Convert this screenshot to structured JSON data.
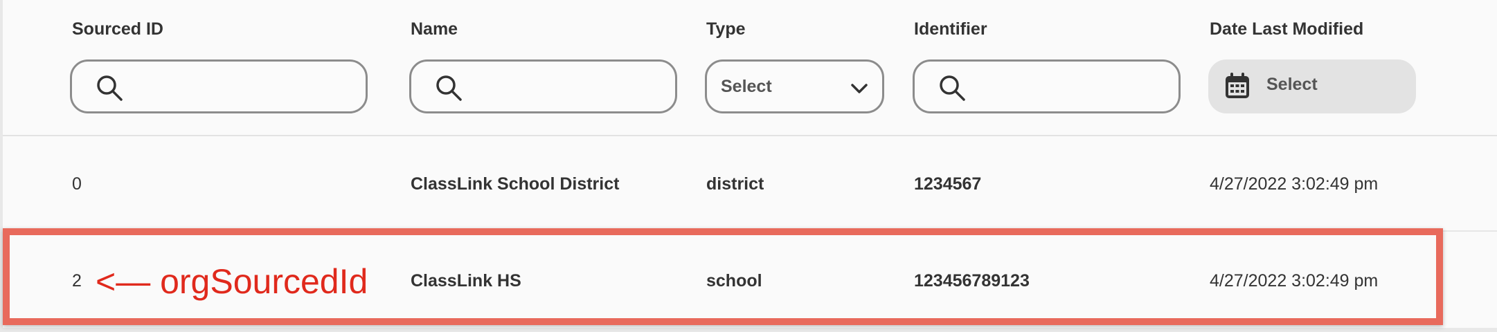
{
  "columns": {
    "sourced_id": "Sourced ID",
    "name": "Name",
    "type": "Type",
    "identifier": "Identifier",
    "date_last_modified": "Date Last Modified"
  },
  "filters": {
    "sourced_id_value": "",
    "name_value": "",
    "type_select": "Select",
    "identifier_value": "",
    "date_select": "Select"
  },
  "rows": [
    {
      "sourced_id": "0",
      "name": "ClassLink School District",
      "type": "district",
      "identifier": "1234567",
      "date_last_modified": "4/27/2022 3:02:49 pm"
    },
    {
      "sourced_id": "2",
      "name": "ClassLink HS",
      "type": "school",
      "identifier": "123456789123",
      "date_last_modified": "4/27/2022 3:02:49 pm"
    }
  ],
  "annotation": {
    "text": "<— orgSourcedId",
    "color": "#e0291c",
    "box_color": "#e86a5c"
  },
  "icons": {
    "search": "search-icon",
    "chevron": "chevron-down-icon",
    "calendar": "calendar-icon"
  }
}
